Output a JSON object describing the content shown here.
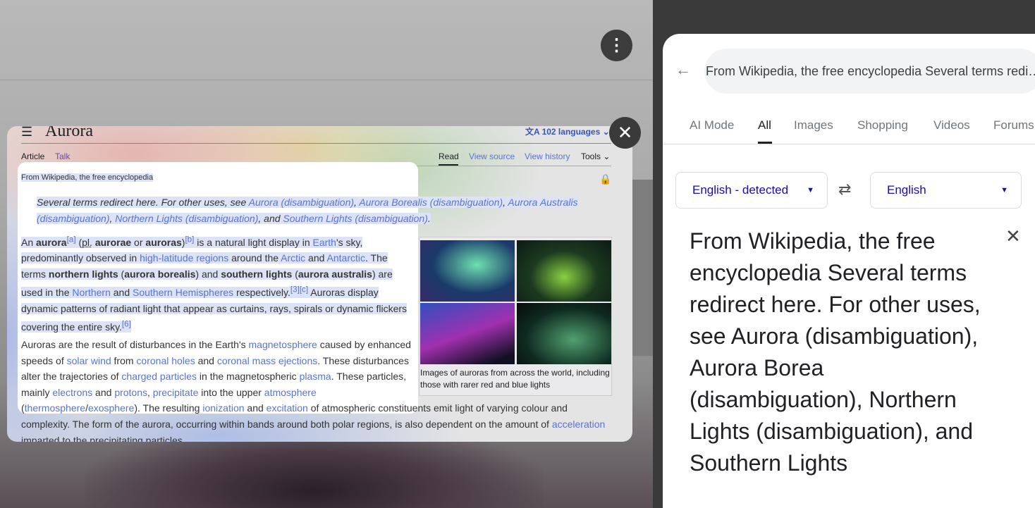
{
  "overlay": {
    "menu_icon": "more-vert-icon",
    "close_icon": "close-icon"
  },
  "wiki": {
    "title": "Aurora",
    "languages": "102 languages",
    "tabs_left": [
      "Article",
      "Talk"
    ],
    "tabs_right": [
      "Read",
      "View source",
      "View history",
      "Tools"
    ],
    "tagline": "From Wikipedia, the free encyclopedia",
    "hatnote": {
      "pre": "Several terms redirect here. For other uses, see ",
      "l1": "Aurora (disambiguation)",
      "s1": ", ",
      "l2": "Aurora Borealis (disambiguation)",
      "s2": ", ",
      "l3": "Aurora Australis (disambiguation)",
      "s3": ", ",
      "l4": "Northern Lights (disambiguation)",
      "s4": ", and ",
      "l5": "Southern Lights (disambiguation)",
      "s5": "."
    },
    "p1": {
      "t0": "An ",
      "b0": "aurora",
      "r0": "[a]",
      "t1": " (",
      "ab": "pl.",
      "t2": " ",
      "b1": "aurorae",
      "t3": " or ",
      "b2": "auroras",
      "t4": ")",
      "r1": "[b]",
      "t5": " is a natural light display in ",
      "l0": "Earth",
      "t6": "'s sky, predominantly observed in ",
      "l1": "high-latitude regions",
      "t7": " around the ",
      "l2": "Arctic",
      "t8": " and ",
      "l3": "Antarctic",
      "t9": ". The terms ",
      "b3": "northern lights",
      "t10": " (",
      "b4": "aurora borealis",
      "t11": ") and ",
      "b5": "southern lights",
      "t12": " (",
      "b6": "aurora australis",
      "t13": ") are used in the ",
      "l4": "Northern",
      "t14": " and ",
      "l5": "Southern Hemispheres",
      "t15": " respectively.",
      "r2": "[3][c]",
      "t16": " Auroras display dynamic patterns of radiant light that appear as curtains, rays, spirals or dynamic flickers covering the entire sky.",
      "r3": "[6]"
    },
    "p2": {
      "t0": "Auroras are the result of disturbances in the Earth's ",
      "l0": "magnetosphere",
      "t1": " caused by enhanced speeds of ",
      "l1": "solar wind",
      "t2": " from ",
      "l2": "coronal holes",
      "t3": " and ",
      "l3": "coronal mass ejections",
      "t4": ". These disturbances alter the trajectories of ",
      "l4": "charged particles",
      "t5": " in the magnetospheric ",
      "l5": "plasma",
      "t6": ". These particles, mainly ",
      "l6": "electrons",
      "t7": " and ",
      "l7": "protons",
      "t8": ", ",
      "l8": "precipitate",
      "t9": " into the upper ",
      "l9": "atmosphere",
      "t10": " (",
      "l10": "thermosphere",
      "t11": "/",
      "l11": "exosphere",
      "t12": "). The resulting ",
      "l12": "ionization",
      "t13": " and ",
      "l13": "excitation",
      "t14": " of atmospheric constituents emit light of varying colour and complexity. The form of the aurora, occurring within bands around both polar regions, is also dependent on the amount of ",
      "l14": "acceleration",
      "t15": " imparted to the precipitating particles."
    },
    "caption": "Images of auroras from across the world, including those with rarer red and blue lights"
  },
  "google": {
    "query": "From Wikipedia, the free encyclopedia Several terms redi…",
    "tabs": [
      "AI Mode",
      "All",
      "Images",
      "Shopping",
      "Videos",
      "Forums"
    ],
    "active_tab": "All",
    "source_lang": "English - detected",
    "target_lang": "English",
    "output": "From Wikipedia, the free encyclopedia Several terms redirect here. For other uses, see Aurora (disambiguation), Aurora Borea (disambiguation), Northern Lights (disambiguation), and Southern Lights"
  }
}
